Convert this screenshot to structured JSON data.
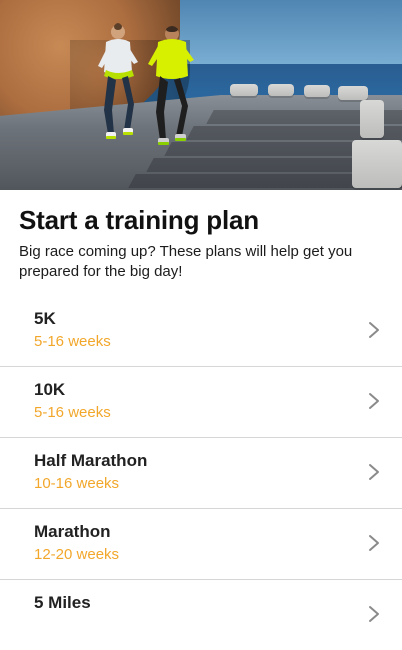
{
  "hero": {
    "image_description": "photo-runners-coastal-road"
  },
  "header": {
    "title": "Start a training plan",
    "subtitle": "Big race coming up? These plans will help get you prepared for the big day!"
  },
  "plans": [
    {
      "name": "5K",
      "weeks": "5-16 weeks"
    },
    {
      "name": "10K",
      "weeks": "5-16 weeks"
    },
    {
      "name": "Half Marathon",
      "weeks": "10-16 weeks"
    },
    {
      "name": "Marathon",
      "weeks": "12-20 weeks"
    },
    {
      "name": "5 Miles",
      "weeks": ""
    }
  ],
  "icons": {
    "row_chevron": "chevron-right-icon"
  },
  "colors": {
    "accent": "#f2a72b",
    "title": "#111111",
    "divider": "#d6d6d6",
    "chevron": "#8a8a8a"
  }
}
